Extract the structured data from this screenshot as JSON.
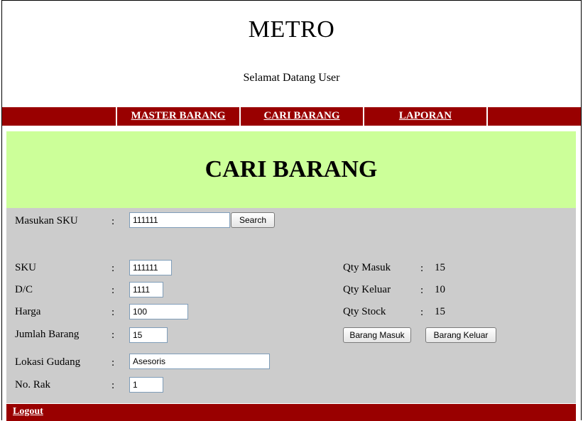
{
  "header": {
    "title": "METRO",
    "welcome": "Selamat Datang User"
  },
  "nav": {
    "items": [
      {
        "label": "MASTER BARANG"
      },
      {
        "label": "CARI BARANG"
      },
      {
        "label": "LAPORAN"
      }
    ]
  },
  "banner": {
    "title": "CARI BARANG"
  },
  "search": {
    "label": "Masukan SKU",
    "colon": ":",
    "value": "111111",
    "button": "Search"
  },
  "form": {
    "sku": {
      "label": "SKU",
      "colon": ":",
      "value": "111111"
    },
    "dc": {
      "label": "D/C",
      "colon": ":",
      "value": "1111"
    },
    "harga": {
      "label": "Harga",
      "colon": ":",
      "value": "100"
    },
    "jumlah": {
      "label": "Jumlah Barang",
      "colon": ":",
      "value": "15"
    },
    "lokasi": {
      "label": "Lokasi Gudang",
      "colon": ":",
      "value": "Asesoris"
    },
    "rak": {
      "label": "No. Rak",
      "colon": ":",
      "value": "1"
    }
  },
  "qty": {
    "masuk": {
      "label": "Qty Masuk",
      "colon": ":",
      "value": "15"
    },
    "keluar": {
      "label": "Qty Keluar",
      "colon": ":",
      "value": "10"
    },
    "stock": {
      "label": "Qty Stock",
      "colon": ":",
      "value": "15"
    }
  },
  "actions": {
    "masuk": "Barang Masuk",
    "keluar": "Barang Keluar"
  },
  "footer": {
    "logout": "Logout"
  }
}
